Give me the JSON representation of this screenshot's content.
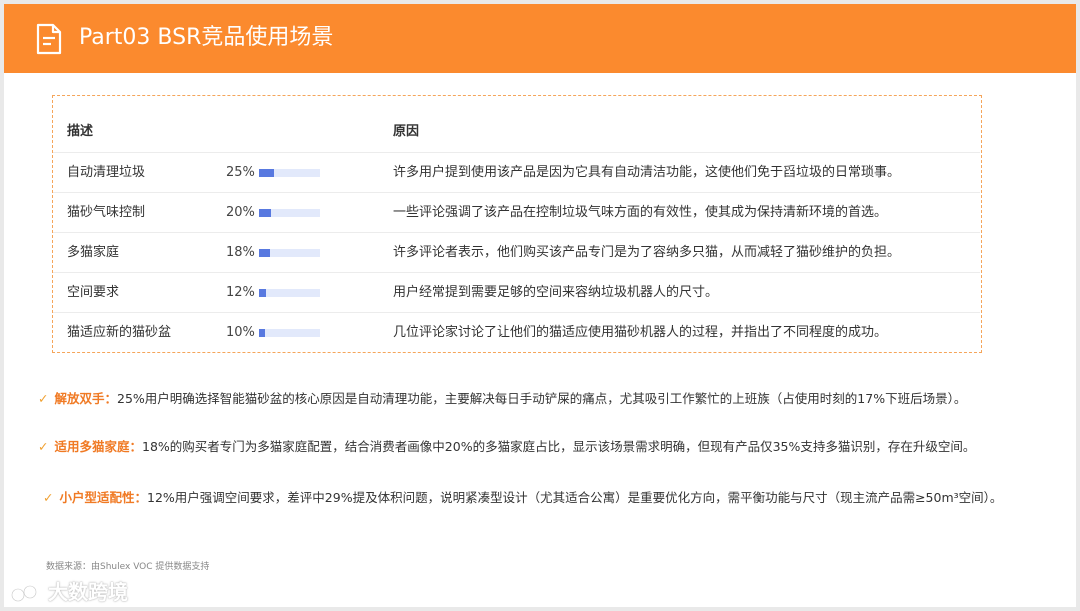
{
  "header": {
    "title": "Part03 BSR竞品使用场景"
  },
  "table": {
    "headers": {
      "desc": "描述",
      "reason": "原因"
    },
    "rows": [
      {
        "desc": "自动清理垃圾",
        "pct_label": "25%",
        "pct": 0.25,
        "reason": "许多用户提到使用该产品是因为它具有自动清洁功能，这使他们免于舀垃圾的日常琐事。"
      },
      {
        "desc": "猫砂气味控制",
        "pct_label": "20%",
        "pct": 0.2,
        "reason": "一些评论强调了该产品在控制垃圾气味方面的有效性，使其成为保持清新环境的首选。"
      },
      {
        "desc": "多猫家庭",
        "pct_label": "18%",
        "pct": 0.18,
        "reason": "许多评论者表示，他们购买该产品专门是为了容纳多只猫，从而减轻了猫砂维护的负担。"
      },
      {
        "desc": "空间要求",
        "pct_label": "12%",
        "pct": 0.12,
        "reason": "用户经常提到需要足够的空间来容纳垃圾机器人的尺寸。"
      },
      {
        "desc": "猫适应新的猫砂盆",
        "pct_label": "10%",
        "pct": 0.1,
        "reason": "几位评论家讨论了让他们的猫适应使用猫砂机器人的过程，并指出了不同程度的成功。"
      }
    ],
    "bar_track_color": "#e2e9fb",
    "bar_fill_color": "#5879e0"
  },
  "bullets": [
    {
      "label": "解放双手：",
      "text": "25%用户明确选择智能猫砂盆的核心原因是自动清理功能，主要解决每日手动铲屎的痛点，尤其吸引工作繁忙的上班族（占使用时刻的17%下班后场景）。"
    },
    {
      "label": "适用多猫家庭：",
      "text": "18%的购买者专门为多猫家庭配置，结合消费者画像中20%的多猫家庭占比，显示该场景需求明确，但现有产品仅35%支持多猫识别，存在升级空间。"
    },
    {
      "label": "小户型适配性：",
      "text": "12%用户强调空间要求，差评中29%提及体积问题，说明紧凑型设计（尤其适合公寓）是重要优化方向，需平衡功能与尺寸（现主流产品需≥50m³空间）。"
    }
  ],
  "footer": {
    "source": "数据来源：由Shulex VOC 提供数据支持",
    "watermark": "大数跨境"
  },
  "colors": {
    "accent": "#fb8a2e",
    "check": "#f0a030",
    "bullet_label": "#f07a24"
  },
  "icons": {
    "header": "document-icon",
    "bullet": "check-icon"
  }
}
